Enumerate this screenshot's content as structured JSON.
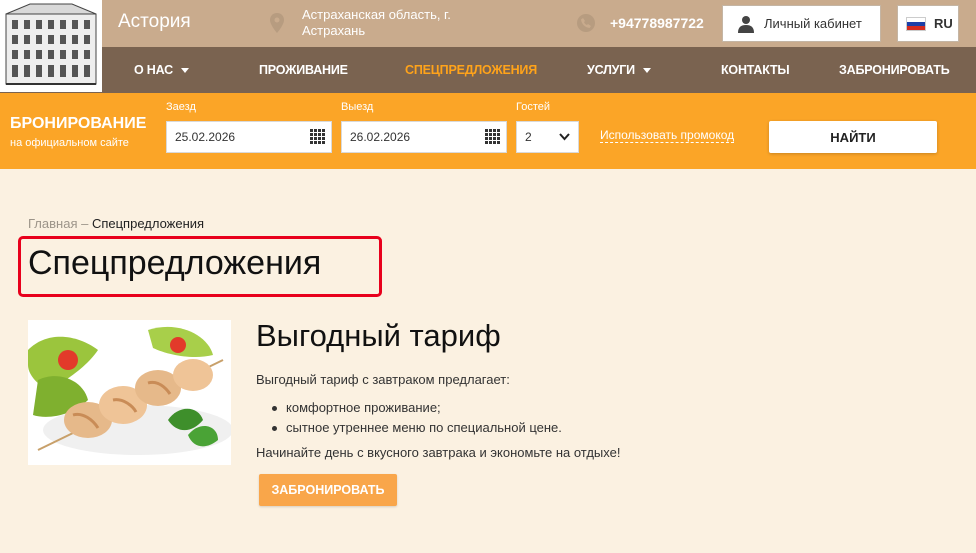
{
  "header": {
    "hotel_name": "Астория",
    "address": "Астраханская область, г. Астрахань",
    "phone": "+94778987722",
    "cabinet_label": "Личный кабинет",
    "lang_label": "RU"
  },
  "nav": {
    "items": [
      {
        "label": "О НАС"
      },
      {
        "label": "ПРОЖИВАНИЕ"
      },
      {
        "label": "СПЕЦПРЕДЛОЖЕНИЯ"
      },
      {
        "label": "УСЛУГИ"
      },
      {
        "label": "КОНТАКТЫ"
      },
      {
        "label": "ЗАБРОНИРОВАТЬ"
      }
    ]
  },
  "booking": {
    "title": "БРОНИРОВАНИЕ",
    "subtitle": "на официальном сайте",
    "checkin_label": "Заезд",
    "checkin_value": "25.02.2026",
    "checkout_label": "Выезд",
    "checkout_value": "26.02.2026",
    "guests_label": "Гостей",
    "guests_value": "2",
    "promo_label": "Использовать промокод",
    "find_label": "НАЙТИ"
  },
  "breadcrumb": {
    "home": "Главная",
    "separator": " – ",
    "current": "Спецпредложения"
  },
  "page_title": "Спецпредложения",
  "offer": {
    "title": "Выгодный тариф",
    "intro": "Выгодный тариф с завтраком предлагает:",
    "items": [
      "комфортное проживание;",
      "сытное утреннее меню по специальной цене."
    ],
    "outro": "Начинайте день с вкусного завтрака и экономьте на отдыхе!",
    "button_label": "ЗАБРОНИРОВАТЬ"
  },
  "colors": {
    "header_bg": "#c9ab8d",
    "nav_bg": "#7a6350",
    "booking_bg": "#fba527",
    "accent": "#ffa31a",
    "highlight_border": "#e8001c"
  }
}
